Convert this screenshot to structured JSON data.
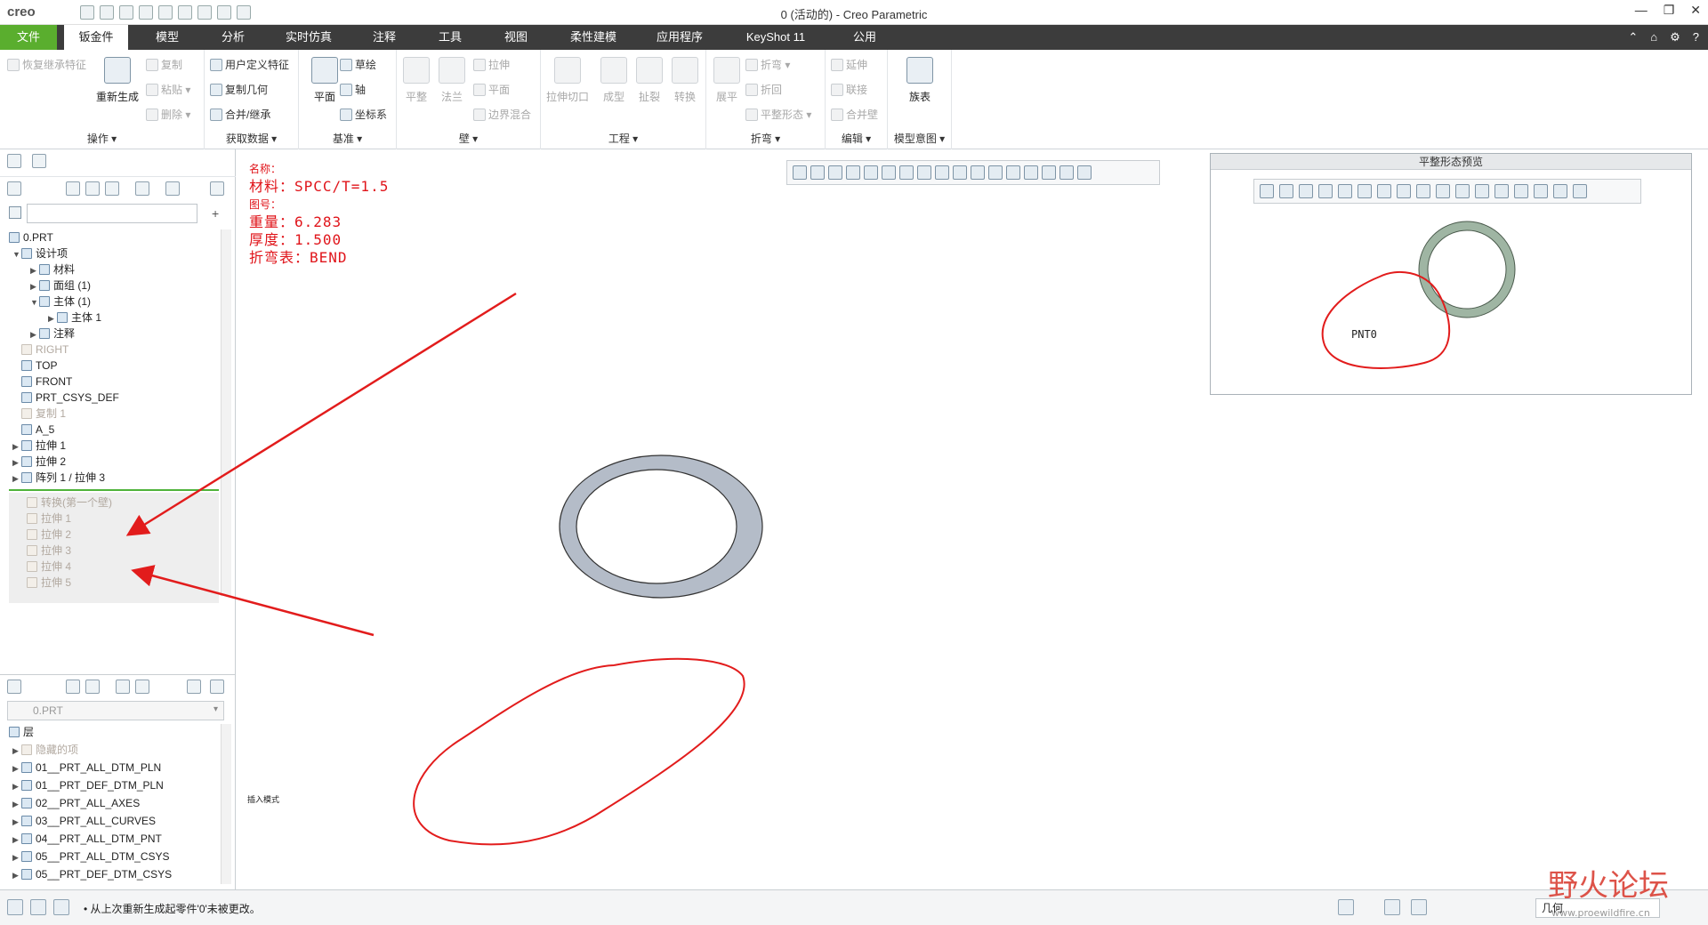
{
  "app": {
    "logo": "creo",
    "window_title": "0 (活动的) - Creo Parametric",
    "window_controls": [
      "—",
      "❐",
      "✕"
    ]
  },
  "tabs": [
    {
      "label": "文件"
    },
    {
      "label": "钣金件"
    },
    {
      "label": "模型"
    },
    {
      "label": "分析"
    },
    {
      "label": "实时仿真"
    },
    {
      "label": "注释"
    },
    {
      "label": "工具"
    },
    {
      "label": "视图"
    },
    {
      "label": "柔性建模"
    },
    {
      "label": "应用程序"
    },
    {
      "label": "KeyShot 11"
    },
    {
      "label": "公用"
    }
  ],
  "tab_right": [
    "⌃",
    "⌂",
    "⚙",
    "?"
  ],
  "ribbon": {
    "ops": {
      "label": "操作 ▾",
      "restore": "恢复继承特征",
      "regen": "重新生成",
      "copy": "复制",
      "paste": "粘贴 ▾",
      "delete": "删除 ▾"
    },
    "getdata": {
      "label": "获取数据 ▾",
      "udf": "用户定义特征",
      "copygeom": "复制几何",
      "merge": "合并/继承"
    },
    "datum": {
      "label": "基准 ▾",
      "plane": "平面",
      "sketch": "草绘",
      "axis": "轴",
      "csys": "坐标系"
    },
    "wall": {
      "label": "壁 ▾",
      "planar": "平整",
      "flange": "法兰",
      "extrude": "拉伸",
      "flat": "平面",
      "blend": "边界混合"
    },
    "eng": {
      "label": "工程 ▾",
      "cut": "拉伸切口",
      "form": "成型",
      "rip": "扯裂",
      "convert": "转换"
    },
    "bend": {
      "label": "折弯 ▾",
      "unbend": "展平",
      "bend": "折弯 ▾",
      "bendback": "折回",
      "flatform": "平整形态 ▾"
    },
    "edit": {
      "label": "编辑 ▾",
      "extend": "延伸",
      "join": "联接",
      "mergewall": "合并壁"
    },
    "intent": {
      "label": "模型意图 ▾",
      "table": "族表"
    }
  },
  "model_tree": {
    "root": "0.PRT",
    "items": [
      {
        "label": "设计项",
        "dim": false
      },
      {
        "label": "材料",
        "dim": false
      },
      {
        "label": "面组 (1)",
        "dim": false
      },
      {
        "label": "主体 (1)",
        "dim": false
      },
      {
        "label": "主体 1",
        "dim": false
      },
      {
        "label": "注释",
        "dim": false
      },
      {
        "label": "RIGHT",
        "dim": true
      },
      {
        "label": "TOP",
        "dim": false
      },
      {
        "label": "FRONT",
        "dim": false
      },
      {
        "label": "PRT_CSYS_DEF",
        "dim": false
      },
      {
        "label": "复制 1",
        "dim": true
      },
      {
        "label": "A_5",
        "dim": false
      },
      {
        "label": "拉伸 1",
        "dim": false
      },
      {
        "label": "拉伸 2",
        "dim": false
      },
      {
        "label": "阵列 1 / 拉伸 3",
        "dim": false
      }
    ],
    "after_insert": [
      {
        "label": "转换(第一个壁)"
      },
      {
        "label": "拉伸 1"
      },
      {
        "label": "拉伸 2"
      },
      {
        "label": "拉伸 3"
      },
      {
        "label": "拉伸 4"
      },
      {
        "label": "拉伸 5"
      }
    ]
  },
  "layer_tree": {
    "selector": "0.PRT",
    "header": "层",
    "items": [
      {
        "label": "隐藏的项",
        "dim": true
      },
      {
        "label": "01__PRT_ALL_DTM_PLN",
        "dim": false
      },
      {
        "label": "01__PRT_DEF_DTM_PLN",
        "dim": false
      },
      {
        "label": "02__PRT_ALL_AXES",
        "dim": false
      },
      {
        "label": "03__PRT_ALL_CURVES",
        "dim": false
      },
      {
        "label": "04__PRT_ALL_DTM_PNT",
        "dim": false
      },
      {
        "label": "05__PRT_ALL_DTM_CSYS",
        "dim": false
      },
      {
        "label": "05__PRT_DEF_DTM_CSYS",
        "dim": false
      }
    ]
  },
  "info_text": {
    "name": "名称：",
    "material": "材料：SPCC/T=1.5",
    "drawno": "图号：",
    "weight": "重量：6.283",
    "thickness": "厚度：1.500",
    "bendtable": "折弯表：BEND"
  },
  "canvas_note": "插入模式",
  "preview": {
    "title": "平整形态预览",
    "point": "PNT0"
  },
  "status": {
    "message": "• 从上次重新生成起零件'0'未被更改。",
    "filter": "几何"
  },
  "watermark": {
    "text": "野火论坛",
    "url": "www.proewildfire.cn"
  },
  "colors": {
    "file_tab": "#5aae2e",
    "tabbar": "#3c3c3c",
    "annotation": "#e0141a",
    "ring_main": "#b4bcc8",
    "ring_preview": "#9fb5a3"
  }
}
